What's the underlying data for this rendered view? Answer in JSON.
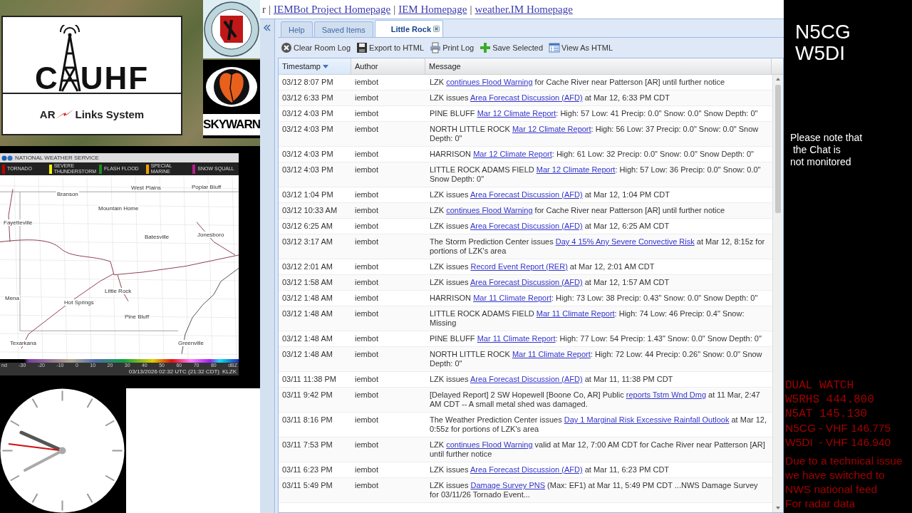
{
  "branding": {
    "logo": {
      "word_before": "C",
      "word_after": "UHF",
      "tagline_before": "AR",
      "tagline_after": "Links System"
    },
    "skywarn": "SKYWARN"
  },
  "radar": {
    "agency": "NATIONAL WEATHER SERVICE",
    "legend": [
      {
        "label": "TORNADO",
        "color": "#c00000"
      },
      {
        "label": "SEVERE THUNDERSTORM",
        "color": "#f2f200"
      },
      {
        "label": "FLASH FLOOD",
        "color": "#1e8c1e"
      },
      {
        "label": "SPECIAL MARINE",
        "color": "#f0a000"
      },
      {
        "label": "SNOW SQUALL",
        "color": "#b0208a"
      }
    ],
    "cities": [
      "Branson",
      "West Plains",
      "Poplar Bluff",
      "Mountain Home",
      "Fayetteville",
      "Batesville",
      "Jonesboro",
      "Mena",
      "Hot Springs",
      "Little Rock",
      "Pine Bluff",
      "Texarkana",
      "Greenville"
    ],
    "scale_ticks": [
      "nd",
      "-30",
      "-20",
      "-10",
      "0",
      "10",
      "20",
      "30",
      "40",
      "50",
      "60",
      "70",
      "80",
      "dBZ"
    ],
    "timestamp": "03/13/2026 02:32 UTC (21:32 CDT)",
    "station": "KLZK"
  },
  "header_links": {
    "cut_text": "r",
    "separator": "|",
    "links": [
      "IEMBot Project Homepage",
      "IEM Homepage",
      "weather.IM Homepage"
    ]
  },
  "tabs": [
    {
      "label": "Help",
      "selected": false,
      "closable": false
    },
    {
      "label": "Saved Items",
      "selected": false,
      "closable": false
    },
    {
      "label": "Little Rock",
      "selected": true,
      "closable": true
    }
  ],
  "toolbar": [
    {
      "label": "Clear Room Log",
      "kind": "clear"
    },
    {
      "label": "Export to HTML",
      "kind": "export"
    },
    {
      "label": "Print Log",
      "kind": "print"
    },
    {
      "label": "Save Selected",
      "kind": "save"
    },
    {
      "label": "View As HTML",
      "kind": "view"
    }
  ],
  "columns": [
    {
      "label": "Timestamp",
      "sorted": true
    },
    {
      "label": "Author",
      "sorted": false
    },
    {
      "label": "Message",
      "sorted": false
    }
  ],
  "rows": [
    {
      "time": "03/12 8:07 PM",
      "author": "iembot",
      "before": "LZK",
      "link": "continues Flood Warning",
      "after": " for Cache River near Patterson [AR] until further notice"
    },
    {
      "time": "03/12 6:33 PM",
      "author": "iembot",
      "before": "LZK issues",
      "link": "Area Forecast Discussion (AFD)",
      "after": " at Mar 12, 6:33 PM CDT"
    },
    {
      "time": "03/12 4:03 PM",
      "author": "iembot",
      "before": "PINE BLUFF",
      "link": "Mar 12 Climate Report",
      "after": ": High: 57 Low: 41 Precip: 0.0\" Snow: 0.0\" Snow Depth: 0\""
    },
    {
      "time": "03/12 4:03 PM",
      "author": "iembot",
      "before": "NORTH LITTLE ROCK",
      "link": "Mar 12 Climate Report",
      "after": ": High: 56 Low: 37 Precip: 0.0\" Snow: 0.0\" Snow Depth: 0\""
    },
    {
      "time": "03/12 4:03 PM",
      "author": "iembot",
      "before": "HARRISON",
      "link": "Mar 12 Climate Report",
      "after": ": High: 61 Low: 32 Precip: 0.0\" Snow: 0.0\" Snow Depth: 0\""
    },
    {
      "time": "03/12 4:03 PM",
      "author": "iembot",
      "before": "LITTLE ROCK ADAMS FIELD",
      "link": "Mar 12 Climate Report",
      "after": ": High: 57 Low: 36 Precip: 0.0\" Snow: 0.0\" Snow Depth: 0\""
    },
    {
      "time": "03/12 1:04 PM",
      "author": "iembot",
      "before": "LZK issues",
      "link": "Area Forecast Discussion (AFD)",
      "after": " at Mar 12, 1:04 PM CDT"
    },
    {
      "time": "03/12 10:33 AM",
      "author": "iembot",
      "before": "LZK",
      "link": "continues Flood Warning",
      "after": " for Cache River near Patterson [AR] until further notice"
    },
    {
      "time": "03/12 6:25 AM",
      "author": "iembot",
      "before": "LZK issues",
      "link": "Area Forecast Discussion (AFD)",
      "after": " at Mar 12, 6:25 AM CDT"
    },
    {
      "time": "03/12 3:17 AM",
      "author": "iembot",
      "before": "The Storm Prediction Center issues",
      "link": "Day 4 15% Any Severe Convective Risk",
      "after": " at Mar 12, 8:15z for portions of LZK's area"
    },
    {
      "time": "03/12 2:01 AM",
      "author": "iembot",
      "before": "LZK issues",
      "link": "Record Event Report (RER)",
      "after": " at Mar 12, 2:01 AM CDT"
    },
    {
      "time": "03/12 1:58 AM",
      "author": "iembot",
      "before": "LZK issues",
      "link": "Area Forecast Discussion (AFD)",
      "after": " at Mar 12, 1:57 AM CDT"
    },
    {
      "time": "03/12 1:48 AM",
      "author": "iembot",
      "before": "HARRISON",
      "link": "Mar 11 Climate Report",
      "after": ": High: 73 Low: 38 Precip: 0.43\" Snow: 0.0\" Snow Depth: 0\""
    },
    {
      "time": "03/12 1:48 AM",
      "author": "iembot",
      "before": "LITTLE ROCK ADAMS FIELD",
      "link": "Mar 11 Climate Report",
      "after": ": High: 74 Low: 46 Precip: 0.4\" Snow: Missing"
    },
    {
      "time": "03/12 1:48 AM",
      "author": "iembot",
      "before": "PINE BLUFF",
      "link": "Mar 11 Climate Report",
      "after": ": High: 77 Low: 54 Precip: 1.43\" Snow: 0.0\" Snow Depth: 0\""
    },
    {
      "time": "03/12 1:48 AM",
      "author": "iembot",
      "before": "NORTH LITTLE ROCK",
      "link": "Mar 11 Climate Report",
      "after": ": High: 72 Low: 44 Precip: 0.26\" Snow: 0.0\" Snow Depth: 0\""
    },
    {
      "time": "03/11 11:38 PM",
      "author": "iembot",
      "before": "LZK issues",
      "link": "Area Forecast Discussion (AFD)",
      "after": " at Mar 11, 11:38 PM CDT"
    },
    {
      "time": "03/11 9:42 PM",
      "author": "iembot",
      "before": "[Delayed Report] 2 SW Hopewell [Boone Co, AR] Public",
      "link": "reports Tstm Wnd Dmg",
      "after": " at 11 Mar, 2:47 AM CDT -- A small metal shed was damaged."
    },
    {
      "time": "03/11 8:16 PM",
      "author": "iembot",
      "before": "The Weather Prediction Center issues",
      "link": "Day 1 Marginal Risk Excessive Rainfall Outlook",
      "after": " at Mar 12, 0:55z for portions of LZK's area"
    },
    {
      "time": "03/11 7:53 PM",
      "author": "iembot",
      "before": "LZK",
      "link": "continues Flood Warning",
      "after": " valid at Mar 12, 7:00 AM CDT for Cache River near Patterson [AR] until further notice"
    },
    {
      "time": "03/11 6:23 PM",
      "author": "iembot",
      "before": "LZK issues",
      "link": "Area Forecast Discussion (AFD)",
      "after": " at Mar 11, 6:23 PM CDT"
    },
    {
      "time": "03/11 5:49 PM",
      "author": "iembot",
      "before": "LZK issues",
      "link": "Damage Survey PNS",
      "after": " (Max: EF1) at Mar 11, 5:49 PM CDT ...NWS Damage Survey for 03/11/26 Tornado Event..."
    }
  ],
  "side": {
    "callsigns": [
      "N5CG",
      "W5DI"
    ],
    "notice_lines": [
      "Please note that",
      "the Chat is",
      "not monitored"
    ],
    "watch_lines": [
      "DUAL WATCH",
      "W5RHS 444.800",
      "N5AT 145.130"
    ],
    "repeater_lines": [
      "N5CG - VHF 146.775",
      "W5DI  - VHF 146.940"
    ],
    "feed_notice_lines": [
      "Due to a technical issue",
      "we have switched to",
      "NWS national feed",
      "For radar data"
    ]
  }
}
